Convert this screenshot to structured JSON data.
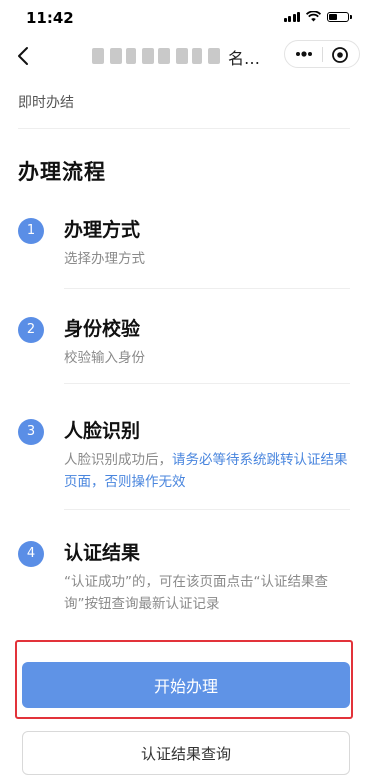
{
  "status_bar": {
    "time": "11:42"
  },
  "nav": {
    "title": "名…"
  },
  "top": {
    "text": "即时办结"
  },
  "section": {
    "title": "办理流程"
  },
  "steps": [
    {
      "num": "1",
      "title": "办理方式",
      "desc": "选择办理方式"
    },
    {
      "num": "2",
      "title": "身份校验",
      "desc": "校验输入身份"
    },
    {
      "num": "3",
      "title": "人脸识别",
      "desc_plain": "人脸识别成功后，",
      "desc_link": "请务必等待系统跳转认证结果页面，否则操作无效"
    },
    {
      "num": "4",
      "title": "认证结果",
      "desc": "“认证成功”的，可在该页面点击“认证结果查询”按钮查询最新认证记录"
    }
  ],
  "buttons": {
    "start": "开始办理",
    "query": "认证结果查询"
  },
  "colors": {
    "accent": "#5f93e6",
    "link": "#4a86de",
    "highlight": "#e2333a"
  }
}
